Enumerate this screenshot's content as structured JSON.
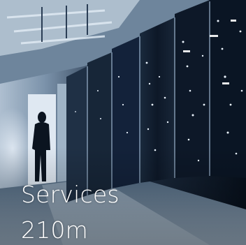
{
  "tile": {
    "title": "Services",
    "value": "210m"
  },
  "photo": {
    "subject": "server-room-corridor"
  },
  "colors": {
    "caption_text": "#ffffff",
    "background_dark": "#0c1626",
    "glow": "#dbe8f5"
  }
}
